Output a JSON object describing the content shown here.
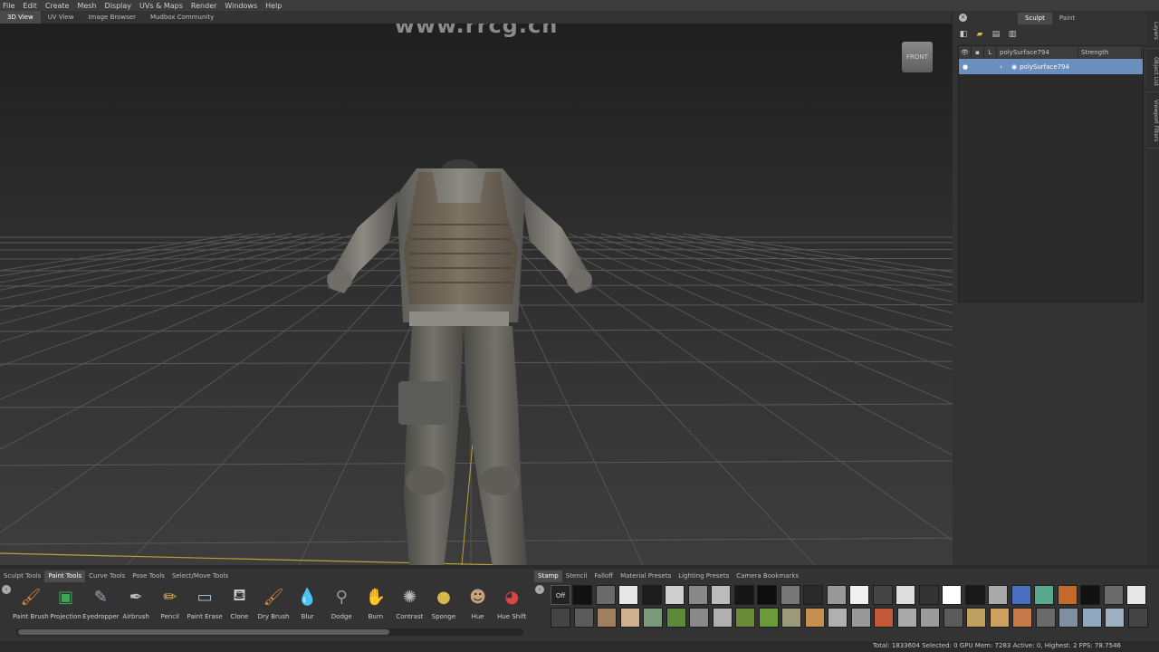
{
  "menu": [
    "File",
    "Edit",
    "Create",
    "Mesh",
    "Display",
    "UVs & Maps",
    "Render",
    "Windows",
    "Help"
  ],
  "view_tabs": [
    "3D View",
    "UV View",
    "Image Browser",
    "Mudbox Community"
  ],
  "watermark": "www.rrcg.cn",
  "viewcube_label": "FRONT",
  "right_panel": {
    "tabs": [
      "Sculpt",
      "Paint"
    ],
    "layers_header": {
      "name": "polySurface794",
      "strength": "Strength"
    },
    "layer_row_name": "polySurface794"
  },
  "side_tabs": [
    "Layers",
    "Object List",
    "Viewport Filters"
  ],
  "tool_tabs": [
    "Sculpt Tools",
    "Paint Tools",
    "Curve Tools",
    "Pose Tools",
    "Select/Move Tools"
  ],
  "tools": [
    {
      "label": "Paint Brush",
      "icon": "paint-brush-icon",
      "glyph": "🖌"
    },
    {
      "label": "Projection",
      "icon": "projection-icon",
      "glyph": "▣"
    },
    {
      "label": "Eyedropper",
      "icon": "eyedropper-icon",
      "glyph": "✎"
    },
    {
      "label": "Airbrush",
      "icon": "airbrush-icon",
      "glyph": "✒"
    },
    {
      "label": "Pencil",
      "icon": "pencil-icon",
      "glyph": "✏"
    },
    {
      "label": "Paint Erase",
      "icon": "eraser-icon",
      "glyph": "▭"
    },
    {
      "label": "Clone",
      "icon": "clone-icon",
      "glyph": "⛾"
    },
    {
      "label": "Dry Brush",
      "icon": "dry-brush-icon",
      "glyph": "🖌"
    },
    {
      "label": "Blur",
      "icon": "blur-icon",
      "glyph": "💧"
    },
    {
      "label": "Dodge",
      "icon": "dodge-icon",
      "glyph": "⚲"
    },
    {
      "label": "Burn",
      "icon": "burn-icon",
      "glyph": "✋"
    },
    {
      "label": "Contrast",
      "icon": "contrast-icon",
      "glyph": "✺"
    },
    {
      "label": "Sponge",
      "icon": "sponge-icon",
      "glyph": "●"
    },
    {
      "label": "Hue",
      "icon": "hue-icon",
      "glyph": "☻"
    },
    {
      "label": "Hue Shift",
      "icon": "hue-shift-icon",
      "glyph": "◕"
    }
  ],
  "stamp_tabs": [
    "Stamp",
    "Stencil",
    "Falloff",
    "Material Presets",
    "Lighting Presets",
    "Camera Bookmarks"
  ],
  "stamp_off_label": "Off",
  "status": "Total: 1833604  Selected: 0 GPU Mem: 7283  Active: 0, Highest: 2  FPS: 78.7546",
  "colors": {
    "selection": "#6b8fbf",
    "panel": "#333333",
    "accent_tab": "#4a4a4a"
  }
}
